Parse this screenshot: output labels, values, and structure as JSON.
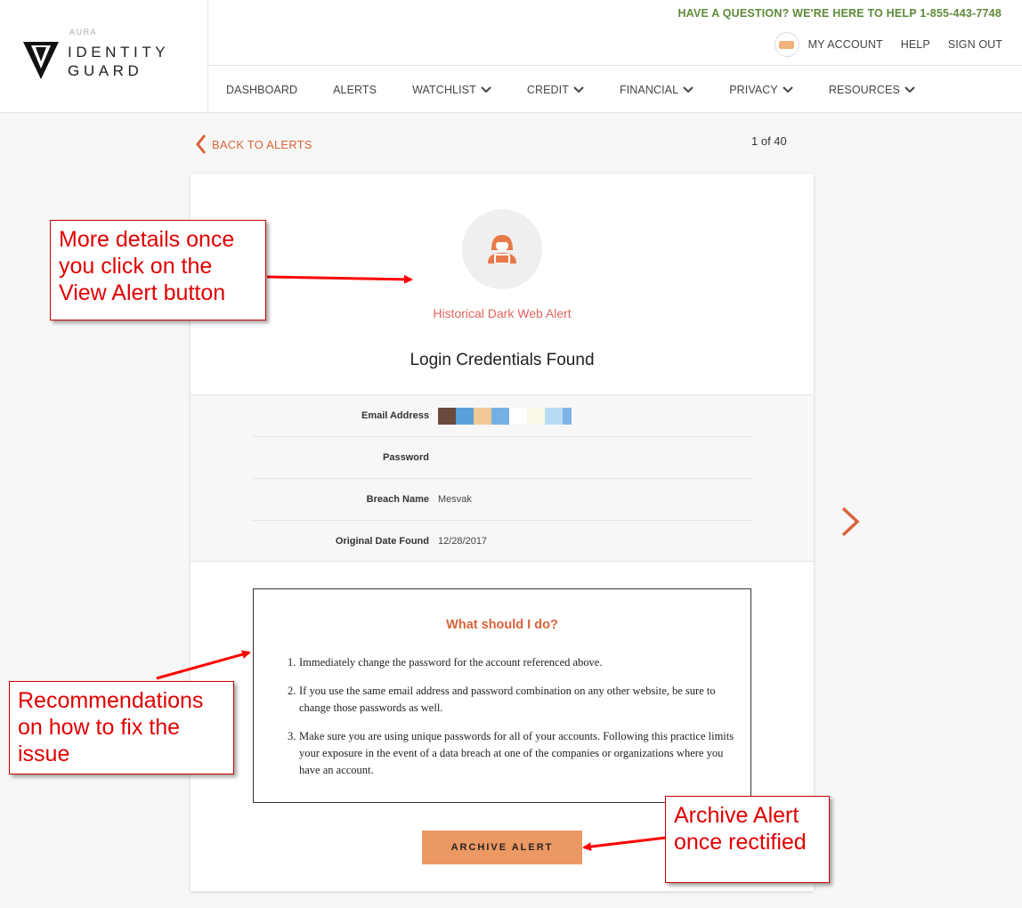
{
  "brand": {
    "aura": "AURA",
    "line1": "IDENTITY",
    "line2": "GUARD"
  },
  "header": {
    "help_text": "HAVE A QUESTION? WE'RE HERE TO HELP 1-855-443-7748",
    "account_links": [
      "MY ACCOUNT",
      "HELP",
      "SIGN OUT"
    ]
  },
  "nav": {
    "items": [
      {
        "label": "DASHBOARD",
        "dropdown": false
      },
      {
        "label": "ALERTS",
        "dropdown": false
      },
      {
        "label": "WATCHLIST",
        "dropdown": true
      },
      {
        "label": "CREDIT",
        "dropdown": true
      },
      {
        "label": "FINANCIAL",
        "dropdown": true
      },
      {
        "label": "PRIVACY",
        "dropdown": true
      },
      {
        "label": "RESOURCES",
        "dropdown": true
      }
    ]
  },
  "back_link": "BACK TO ALERTS",
  "pagination": "1 of 40",
  "alert": {
    "type": "Historical Dark Web Alert",
    "title": "Login Credentials Found",
    "details": [
      {
        "label": "Email Address",
        "value": ""
      },
      {
        "label": "Password",
        "value": ""
      },
      {
        "label": "Breach Name",
        "value": "Mesvak"
      },
      {
        "label": "Original Date Found",
        "value": "12/28/2017"
      }
    ],
    "redacted_email_colors": [
      "#6b4a3e",
      "#5aa0d8",
      "#f0c896",
      "#74b0e3",
      "#ffffff",
      "#fbf8e8",
      "#b8dcf4",
      "#7fb4e6"
    ]
  },
  "recommendations": {
    "title": "What should I do?",
    "items": [
      {
        "num": "1.",
        "text": "Immediately change the password for the account referenced above."
      },
      {
        "num": "2.",
        "text": "If you use the same email address and password combination on any other website, be sure to change those passwords as well."
      },
      {
        "num": "3.",
        "text": "Make sure you are using unique passwords for all of your accounts. Following this practice limits your exposure in the event of a data breach at one of the companies or organizations where you have an account."
      }
    ]
  },
  "archive_button": "ARCHIVE ALERT",
  "annotations": {
    "details_note": "More details once you click on the View Alert button",
    "recommendations_note": "Recommendations on how to fix the issue",
    "archive_note": "Archive Alert once rectified"
  },
  "colors": {
    "accent_orange": "#d9643a",
    "alert_red": "#e0645e",
    "help_green": "#5f8a3a",
    "button_orange": "#ec9863",
    "annotation_red": "#e00000"
  }
}
